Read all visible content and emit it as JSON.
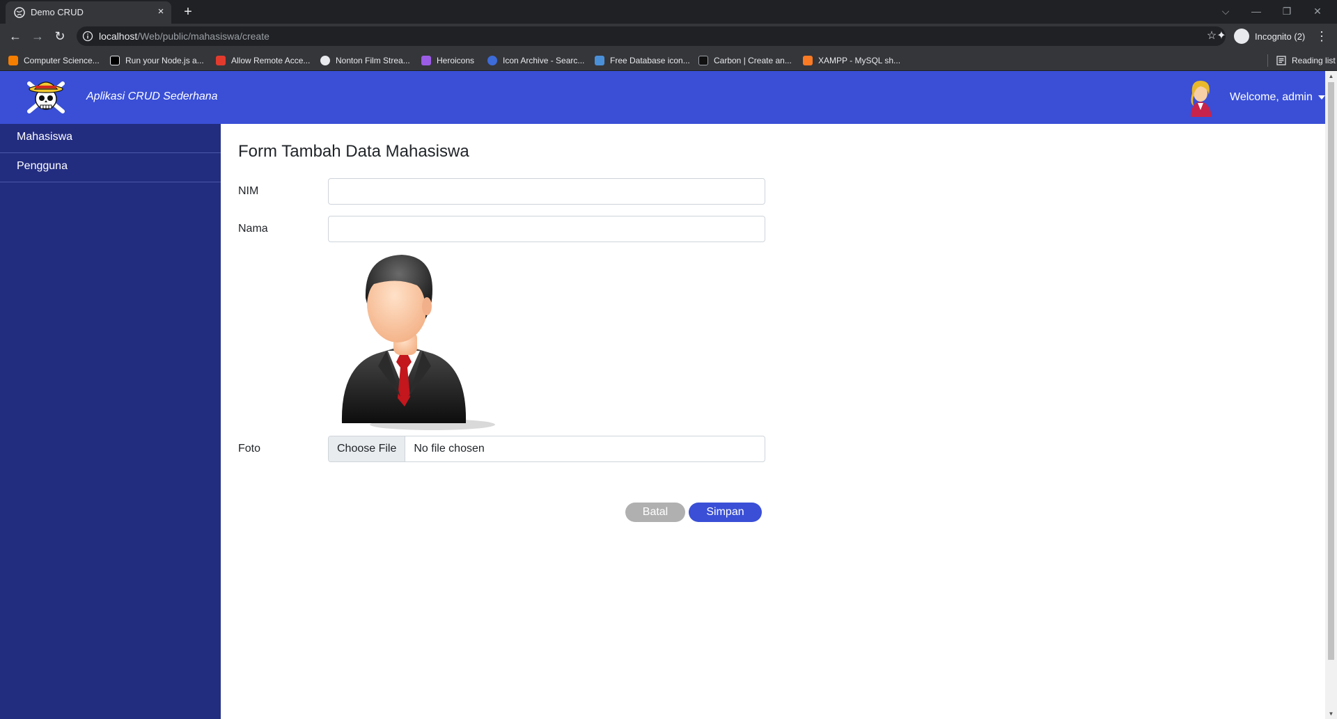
{
  "browser": {
    "tab_title": "Demo CRUD",
    "tab_close": "×",
    "new_tab": "+",
    "url_host": "localhost",
    "url_path": "/Web/public/mahasiswa/create",
    "incognito_label": "Incognito (2)",
    "reading_list": "Reading list",
    "window_controls": [
      "⌵",
      "—",
      "❐",
      "✕"
    ],
    "nav": {
      "back": "←",
      "forward": "→",
      "reload": "↻"
    },
    "star": "☆",
    "extensions": "✦",
    "menu": "⋮",
    "bookmarks": [
      {
        "label": "Computer Science...",
        "icon": "blogger-icon",
        "color": "#f57d00"
      },
      {
        "label": "Run your Node.js a...",
        "icon": "dev-icon",
        "color": "#000000"
      },
      {
        "label": "Allow Remote Acce...",
        "icon": "bookmark-flag-icon",
        "color": "#e23b2e"
      },
      {
        "label": "Nonton Film Strea...",
        "icon": "globe-icon",
        "color": "#e8eaed"
      },
      {
        "label": "Heroicons",
        "icon": "heroicons-icon",
        "color": "#9b5de5"
      },
      {
        "label": "Icon Archive - Searc...",
        "icon": "star-badge-icon",
        "color": "#3d6bd8"
      },
      {
        "label": "Free Database icon...",
        "icon": "database-icon",
        "color": "#4a90d9"
      },
      {
        "label": "Carbon | Create an...",
        "icon": "carbon-icon",
        "color": "#111111"
      },
      {
        "label": "XAMPP - MySQL sh...",
        "icon": "xampp-icon",
        "color": "#fb7a24"
      }
    ]
  },
  "app": {
    "brand": "Aplikasi CRUD Sederhana",
    "welcome": "Welcome, admin",
    "accent_color": "#3a4fd6",
    "sidebar_color": "#232d80",
    "sidebar": [
      {
        "label": "Mahasiswa"
      },
      {
        "label": "Pengguna"
      }
    ]
  },
  "form": {
    "title": "Form Tambah Data Mahasiswa",
    "nim_label": "NIM",
    "nim_value": "",
    "nama_label": "Nama",
    "nama_value": "",
    "foto_label": "Foto",
    "file_button": "Choose File",
    "file_status": "No file chosen",
    "cancel_label": "Batal",
    "submit_label": "Simpan"
  }
}
